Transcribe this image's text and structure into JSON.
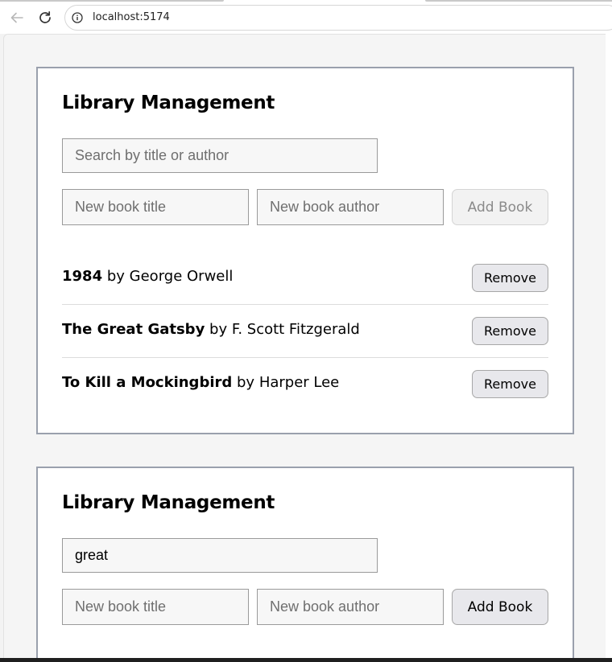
{
  "browser": {
    "url": "localhost:5174"
  },
  "cards": [
    {
      "title": "Library Management",
      "search": {
        "value": "",
        "placeholder": "Search by title or author"
      },
      "new_title": {
        "value": "",
        "placeholder": "New book title"
      },
      "new_author": {
        "value": "",
        "placeholder": "New book author"
      },
      "add_button": {
        "label": "Add Book",
        "state": "disabled"
      },
      "books": [
        {
          "title": "1984",
          "by": "by",
          "author": "George Orwell",
          "remove_label": "Remove"
        },
        {
          "title": "The Great Gatsby",
          "by": "by",
          "author": "F. Scott Fitzgerald",
          "remove_label": "Remove"
        },
        {
          "title": "To Kill a Mockingbird",
          "by": "by",
          "author": "Harper Lee",
          "remove_label": "Remove"
        }
      ]
    },
    {
      "title": "Library Management",
      "search": {
        "value": "great",
        "placeholder": "Search by title or author"
      },
      "new_title": {
        "value": "",
        "placeholder": "New book title"
      },
      "new_author": {
        "value": "",
        "placeholder": "New book author"
      },
      "add_button": {
        "label": "Add Book",
        "state": "enabled"
      }
    }
  ],
  "icons": {
    "back": "arrow-left-icon",
    "reload": "reload-icon",
    "site_info": "info-icon"
  },
  "colors": {
    "card_border": "#9aa0ad",
    "button_bg": "#e8e8ec",
    "page_bg": "#f5f5f5"
  }
}
